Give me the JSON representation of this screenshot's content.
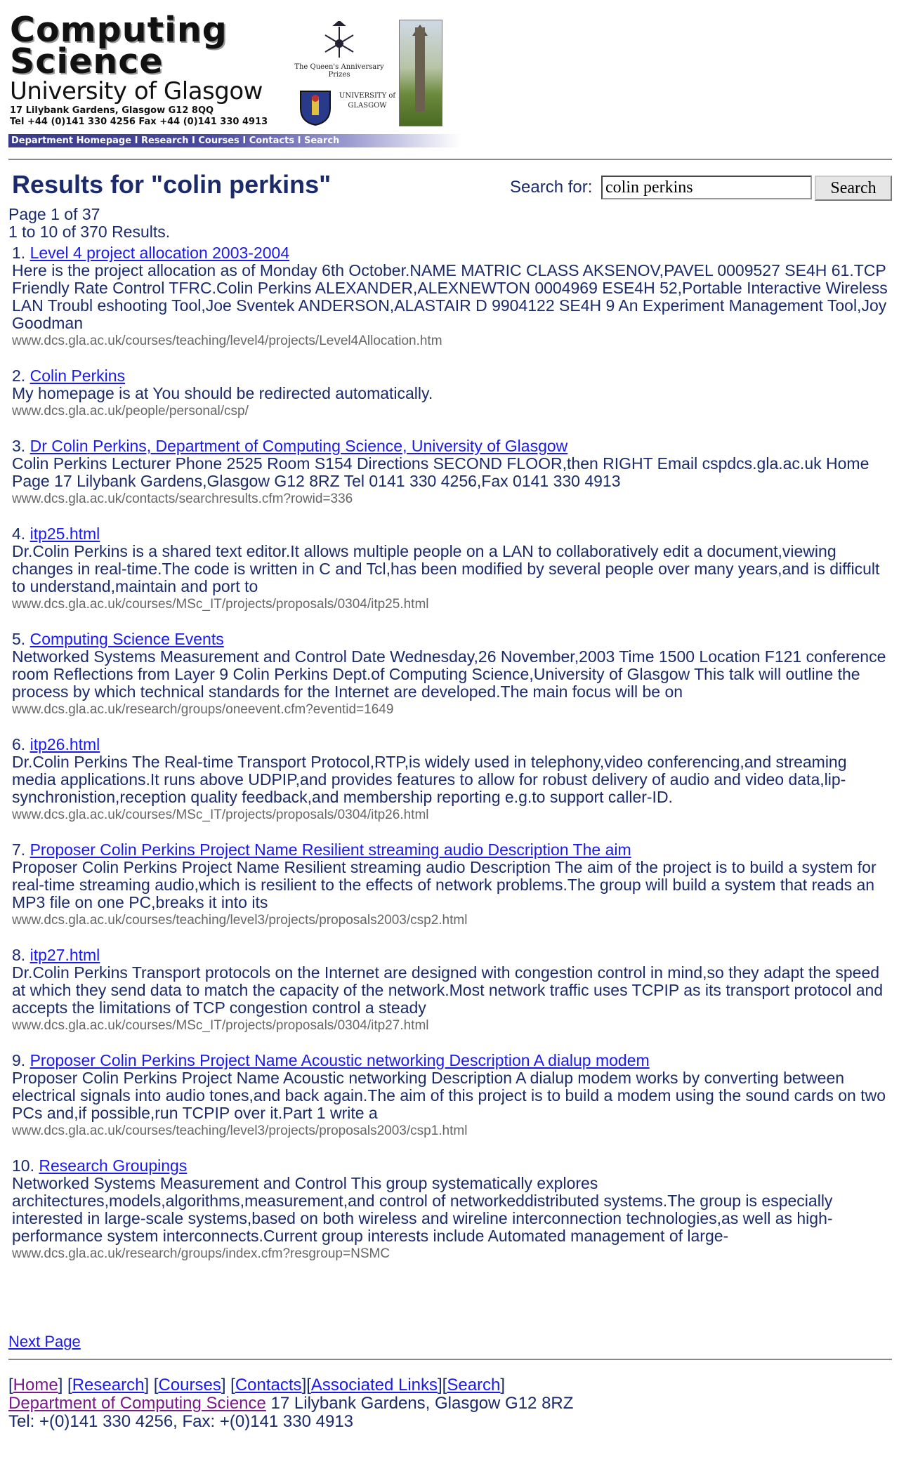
{
  "header": {
    "title_line1": "Computing",
    "title_line2": "Science",
    "university": "University of Glasgow",
    "address_line1": "17 Lilybank Gardens, Glasgow G12 8QQ",
    "address_line2": "Tel +44 (0)141 330 4256 Fax +44 (0)141 330 4913",
    "anniversary_text": "The Queen's Anniversary Prizes",
    "crest_text": "UNIVERSITY of GLASGOW",
    "nav": [
      "Department Homepage",
      "Research",
      "Courses",
      "Contacts",
      "Search"
    ]
  },
  "search": {
    "results_title": "Results for \"colin perkins\"",
    "label": "Search for:",
    "value": "colin perkins",
    "button": "Search"
  },
  "paging": {
    "page": "Page 1 of 37",
    "range": "1 to 10 of 370 Results."
  },
  "results": [
    {
      "num": "1.",
      "title": "Level 4 project allocation 2003-2004",
      "snippet": "Here is the project allocation as of Monday 6th October.NAME MATRIC CLASS AKSENOV,PAVEL 0009527 SE4H 61.TCP Friendly Rate Control TFRC.Colin Perkins ALEXANDER,ALEXNEWTON 0004969 ESE4H 52,Portable Interactive Wireless LAN Troubl eshooting Tool,Joe Sventek ANDERSON,ALASTAIR D 9904122 SE4H 9 An Experiment Management Tool,Joy Goodman",
      "url": "www.dcs.gla.ac.uk/courses/teaching/level4/projects/Level4Allocation.htm"
    },
    {
      "num": "2.",
      "title": "Colin Perkins",
      "snippet": "My homepage is at You should be redirected automatically.",
      "url": "www.dcs.gla.ac.uk/people/personal/csp/"
    },
    {
      "num": "3.",
      "title": "Dr Colin Perkins, Department of Computing Science, University of Glasgow",
      "snippet": "Colin Perkins Lecturer Phone 2525 Room S154 Directions SECOND FLOOR,then RIGHT Email cspdcs.gla.ac.uk Home Page 17 Lilybank Gardens,Glasgow G12 8RZ Tel 0141 330 4256,Fax 0141 330 4913",
      "url": "www.dcs.gla.ac.uk/contacts/searchresults.cfm?rowid=336"
    },
    {
      "num": "4.",
      "title": "itp25.html",
      "snippet": "Dr.Colin Perkins is a shared text editor.It allows multiple people on a LAN to collaboratively edit a document,viewing changes in real-time.The code is written in C and Tcl,has been modified by several people over many years,and is difficult to understand,maintain and port to",
      "url": "www.dcs.gla.ac.uk/courses/MSc_IT/projects/proposals/0304/itp25.html"
    },
    {
      "num": "5.",
      "title": "Computing Science Events",
      "snippet": "Networked Systems Measurement and Control Date Wednesday,26 November,2003 Time 1500 Location F121 conference room Reflections from Layer 9 Colin Perkins Dept.of Computing Science,University of Glasgow This talk will outline the process by which technical standards for the Internet are developed.The main focus will be on",
      "url": "www.dcs.gla.ac.uk/research/groups/oneevent.cfm?eventid=1649"
    },
    {
      "num": "6.",
      "title": "itp26.html",
      "snippet": "Dr.Colin Perkins The Real-time Transport Protocol,RTP,is widely used in telephony,video conferencing,and streaming media applications.It runs above UDPIP,and provides features to allow for robust delivery of audio and video data,lip-synchronistion,reception quality feedback,and membership reporting e.g.to support caller-ID.",
      "url": "www.dcs.gla.ac.uk/courses/MSc_IT/projects/proposals/0304/itp26.html"
    },
    {
      "num": "7.",
      "title": "Proposer Colin Perkins Project Name Resilient streaming audio Description The aim",
      "snippet": "Proposer Colin Perkins Project Name Resilient streaming audio Description The aim of the project is to build a system for real-time streaming audio,which is resilient to the effects of network problems.The group will build a system that reads an MP3 file on one PC,breaks it into its",
      "url": "www.dcs.gla.ac.uk/courses/teaching/level3/projects/proposals2003/csp2.html"
    },
    {
      "num": "8.",
      "title": "itp27.html",
      "snippet": "Dr.Colin Perkins Transport protocols on the Internet are designed with congestion control in mind,so they adapt the speed at which they send data to match the capacity of the network.Most network traffic uses TCPIP as its transport protocol and accepts the limitations of TCP congestion control a steady",
      "url": "www.dcs.gla.ac.uk/courses/MSc_IT/projects/proposals/0304/itp27.html"
    },
    {
      "num": "9.",
      "title": "Proposer Colin Perkins Project Name Acoustic networking Description A dialup modem",
      "snippet": "Proposer Colin Perkins Project Name Acoustic networking Description A dialup modem works by converting between electrical signals into audio tones,and back again.The aim of this project is to build a modem using the sound cards on two PCs and,if possible,run TCPIP over it.Part 1 write a",
      "url": "www.dcs.gla.ac.uk/courses/teaching/level3/projects/proposals2003/csp1.html"
    },
    {
      "num": "10.",
      "title": "Research Groupings",
      "snippet": "Networked Systems Measurement and Control This group systematically explores architectures,models,algorithms,measurement,and control of networkeddistributed systems.The group is especially interested in large-scale systems,based on both wireless and wireline interconnection technologies,as well as high-performance system interconnects.Current group interests include Automated management of large-",
      "url": "www.dcs.gla.ac.uk/research/groups/index.cfm?resgroup=NSMC"
    }
  ],
  "next_page": "Next Page",
  "footer": {
    "links": [
      "Home",
      "Research",
      "Courses",
      "Contacts",
      "Associated Links",
      "Search"
    ],
    "dept_link": "Department of Computing Science",
    "address": " 17 Lilybank Gardens, Glasgow G12 8RZ",
    "tel": "Tel: +(0)141 330 4256, Fax: +(0)141 330 4913"
  }
}
